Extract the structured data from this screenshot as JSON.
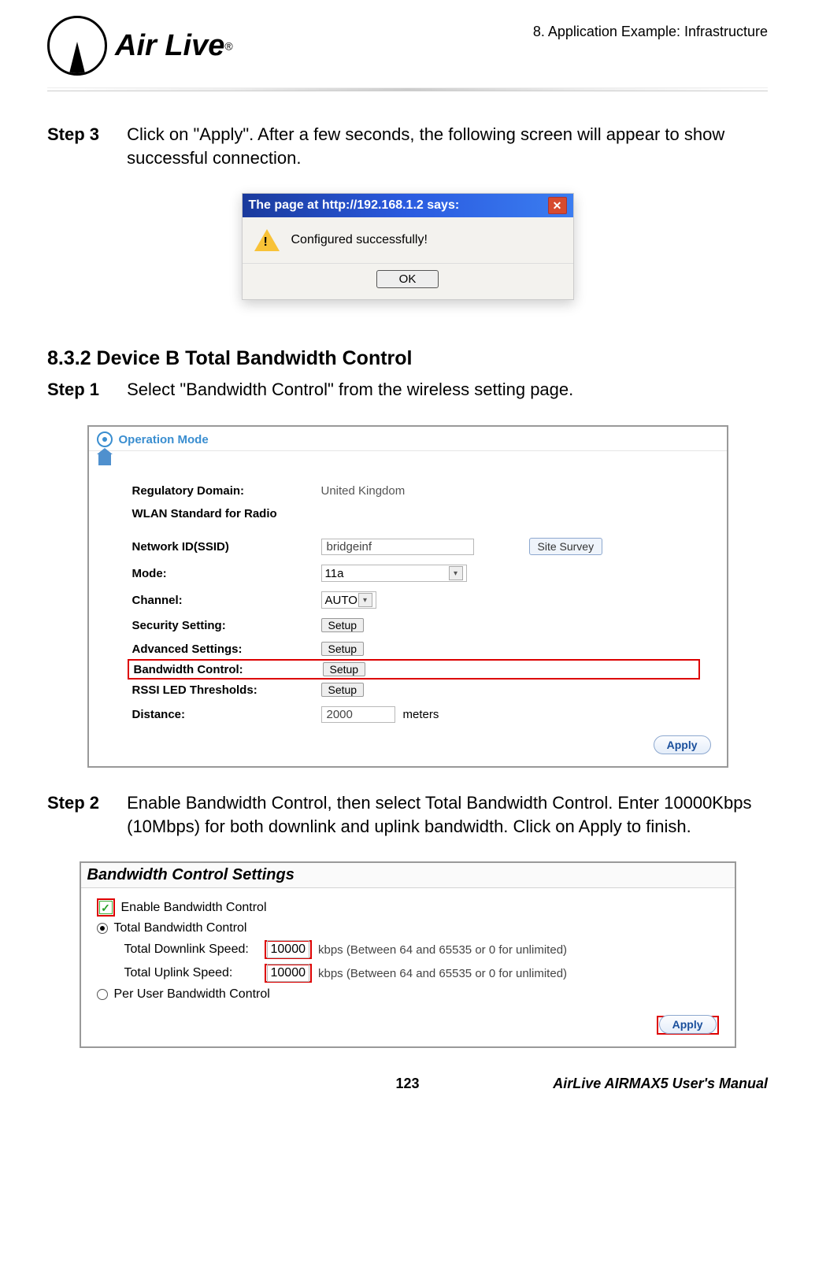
{
  "header": {
    "chapter": "8. Application Example: Infrastructure",
    "logo_text": "Air Live",
    "logo_reg": "®"
  },
  "step3": {
    "label": "Step 3",
    "text": "Click on \"Apply\".    After a few seconds, the following screen will appear to show successful connection."
  },
  "dialog": {
    "title": "The page at http://192.168.1.2 says:",
    "message": "Configured successfully!",
    "ok": "OK"
  },
  "section_title": "8.3.2 Device B Total Bandwidth Control",
  "step1": {
    "label": "Step 1",
    "text": "Select \"Bandwidth Control\" from the wireless setting page."
  },
  "panel": {
    "op_mode": "Operation Mode",
    "reg_domain_label": "Regulatory Domain:",
    "reg_domain_value": "United Kingdom",
    "wlan_std_label": "WLAN Standard for Radio",
    "ssid_label": "Network ID(SSID)",
    "ssid_value": "bridgeinf",
    "site_survey": "Site Survey",
    "mode_label": "Mode:",
    "mode_value": "11a",
    "channel_label": "Channel:",
    "channel_value": "AUTO",
    "security_label": "Security Setting:",
    "advanced_label": "Advanced Settings:",
    "bandwidth_label": "Bandwidth Control:",
    "rssi_label": "RSSI LED Thresholds:",
    "distance_label": "Distance:",
    "distance_value": "2000",
    "distance_unit": "meters",
    "setup": "Setup",
    "apply": "Apply"
  },
  "step2": {
    "label": "Step 2",
    "text": "Enable Bandwidth Control, then select Total Bandwidth Control.   Enter 10000Kbps (10Mbps) for both downlink and uplink bandwidth.   Click on Apply to finish."
  },
  "bw": {
    "title": "Bandwidth Control Settings",
    "enable": "Enable Bandwidth Control",
    "total": "Total Bandwidth Control",
    "dl_label": "Total Downlink Speed:",
    "ul_label": "Total Uplink Speed:",
    "dl_value": "10000",
    "ul_value": "10000",
    "unit_note": "kbps (Between 64 and 65535 or 0 for unlimited)",
    "peruser": "Per User Bandwidth Control",
    "apply": "Apply"
  },
  "footer": {
    "page": "123",
    "manual": "AirLive AIRMAX5 User's Manual"
  }
}
